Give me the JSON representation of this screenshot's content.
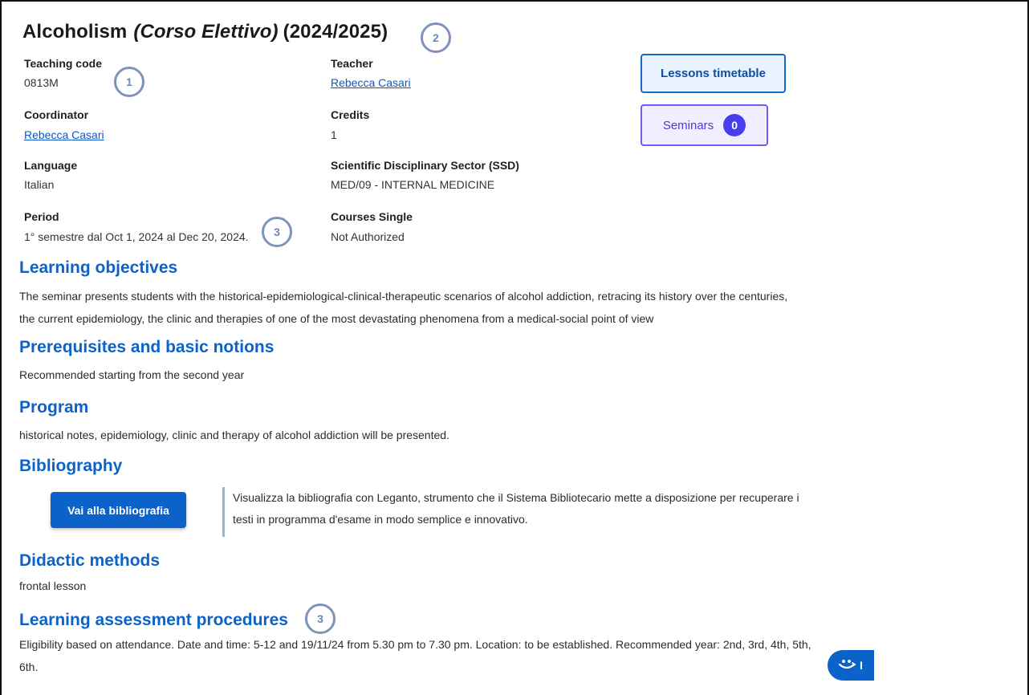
{
  "course": {
    "title": "Alcoholism",
    "title_italic": "(Corso Elettivo)",
    "year": "(2024/2025)"
  },
  "fields": {
    "teaching_code": {
      "label": "Teaching code",
      "value": "0813M"
    },
    "teacher": {
      "label": "Teacher",
      "value": "Rebecca Casari"
    },
    "coordinator": {
      "label": "Coordinator",
      "value": "Rebecca Casari"
    },
    "credits": {
      "label": "Credits",
      "value": "1"
    },
    "language": {
      "label": "Language",
      "value": "Italian"
    },
    "ssd": {
      "label": "Scientific Disciplinary Sector (SSD)",
      "value": "MED/09 - INTERNAL MEDICINE"
    },
    "period": {
      "label": "Period",
      "value": "1° semestre dal Oct 1, 2024 al Dec 20, 2024."
    },
    "courses_single": {
      "label": "Courses Single",
      "value": "Not Authorized"
    }
  },
  "buttons": {
    "timetable": "Lessons timetable",
    "seminars": "Seminars",
    "seminars_count": "0",
    "bibliography": "Vai alla bibliografia"
  },
  "annotations": {
    "a1": "1",
    "a2": "2",
    "a3": "3",
    "a4": "3"
  },
  "sections": {
    "objectives": {
      "heading": "Learning objectives",
      "line1": "The seminar presents students with the historical-epidemiological-clinical-therapeutic scenarios of alcohol addiction, retracing its history over the centuries,",
      "line2": "the current epidemiology, the clinic and therapies of one of the most devastating phenomena from a medical-social point of view"
    },
    "prerequisites": {
      "heading": "Prerequisites and basic notions",
      "text": "Recommended starting from the second year"
    },
    "program": {
      "heading": "Program",
      "text": "historical notes, epidemiology, clinic and therapy of alcohol addiction will be presented."
    },
    "bibliography": {
      "heading": "Bibliography",
      "line1": "Visualizza la bibliografia con Leganto, strumento che il Sistema Bibliotecario mette a disposizione per recuperare i",
      "line2": "testi in programma d'esame in modo semplice e innovativo."
    },
    "didactic": {
      "heading": "Didactic methods",
      "text": "frontal lesson"
    },
    "assessment": {
      "heading": "Learning assessment procedures",
      "line1": "Eligibility based on attendance. Date and time: 5-12 and 19/11/24 from 5.30 pm to 7.30 pm. Location: to be established. Recommended year: 2nd, 3rd, 4th, 5th,",
      "line2": "6th."
    }
  },
  "widget": {
    "label": "I",
    "icon": "smile-chat-icon"
  },
  "colors": {
    "link": "#0a57c8",
    "heading": "#0b63c9",
    "seminar_accent": "#4a3df0",
    "annotation": "#7f93b9"
  }
}
